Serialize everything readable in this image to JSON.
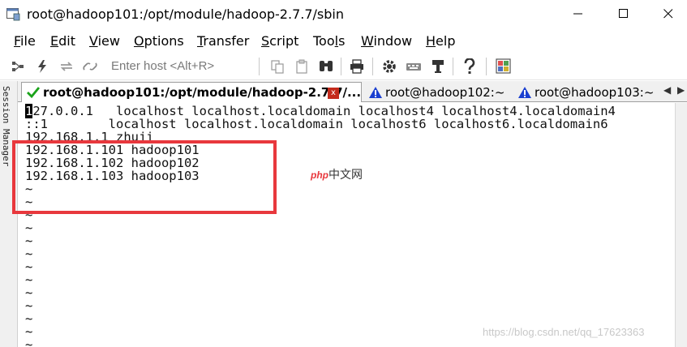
{
  "window": {
    "title": "root@hadoop101:/opt/module/hadoop-2.7.7/sbin",
    "app_icon": "securecrt-terminal-icon",
    "controls": [
      "minimize-icon",
      "maximize-icon",
      "close-icon"
    ]
  },
  "menu": {
    "items": [
      {
        "label": "File",
        "underline": "F",
        "rest": "ile"
      },
      {
        "label": "Edit",
        "underline": "E",
        "rest": "dit"
      },
      {
        "label": "View",
        "underline": "V",
        "rest": "iew"
      },
      {
        "label": "Options",
        "underline": "O",
        "rest": "ptions"
      },
      {
        "label": "Transfer",
        "underline": "T",
        "rest": "ransfer"
      },
      {
        "label": "Script",
        "underline": "S",
        "rest": "cript"
      },
      {
        "label": "Tools",
        "pre": "Too",
        "underline": "l",
        "rest": "s"
      },
      {
        "label": "Window",
        "underline": "W",
        "rest": "indow"
      },
      {
        "label": "Help",
        "underline": "H",
        "rest": "elp"
      }
    ]
  },
  "toolbar": {
    "host_placeholder": "Enter host <Alt+R>",
    "icons": [
      "connect-icon",
      "quick-connect-icon",
      "reconnect-icon",
      "disconnect-icon",
      "copy-icon",
      "paste-icon",
      "find-icon",
      "print-icon",
      "settings-icon",
      "keymap-icon",
      "sftp-icon",
      "help-icon",
      "script-icon"
    ]
  },
  "session_manager": {
    "label": "Session Manager"
  },
  "tabs": [
    {
      "label": "root@hadoop101:/opt/module/hadoop-2.7.7/...",
      "status_icon": "connected-check-icon",
      "active": true
    },
    {
      "label": "root@hadoop102:~",
      "status_icon": "warning-icon",
      "active": false
    },
    {
      "label": "root@hadoop103:~",
      "status_icon": "warning-icon",
      "active": false
    }
  ],
  "terminal": {
    "cursor_char": "1",
    "lines": [
      "27.0.0.1   localhost localhost.localdomain localhost4 localhost4.localdomain4",
      "::1        localhost localhost.localdomain localhost6 localhost6.localdomain6",
      "192.168.1.1 zhuji",
      "192.168.1.101 hadoop101",
      "192.168.1.102 hadoop102",
      "192.168.1.103 hadoop103",
      "~",
      "~",
      "~",
      "~",
      "~",
      "~",
      "~",
      "~",
      "~",
      "~",
      "~",
      "~",
      "~",
      "~",
      "~"
    ]
  },
  "watermarks": {
    "php_mark": "php",
    "php_cn": "中文网",
    "blog": "https://blog.csdn.net/qq_17623363"
  },
  "colors": {
    "highlight": "#e8383d",
    "check": "#1aa31a",
    "warning": "#1a3fd0"
  }
}
